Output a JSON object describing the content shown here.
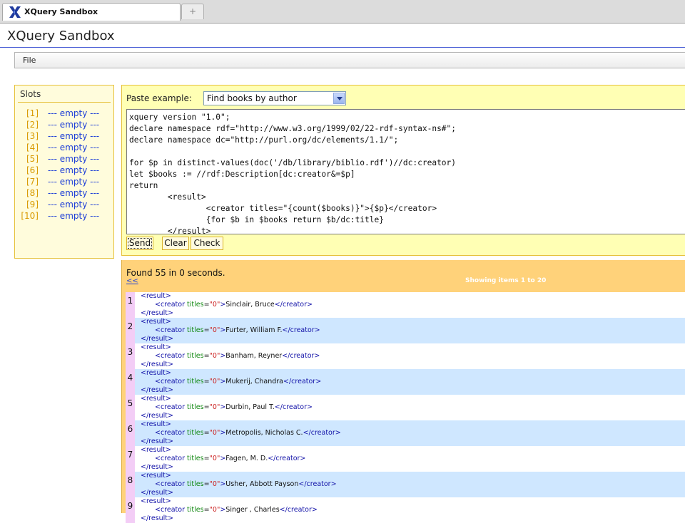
{
  "browser": {
    "tab_title": "XQuery Sandbox",
    "new_tab_symbol": "+"
  },
  "page": {
    "title": "XQuery Sandbox",
    "menu": {
      "file_label": "File"
    }
  },
  "slots": {
    "heading": "Slots",
    "items": [
      {
        "index": "[1]",
        "value": "--- empty ---"
      },
      {
        "index": "[2]",
        "value": "--- empty ---"
      },
      {
        "index": "[3]",
        "value": "--- empty ---"
      },
      {
        "index": "[4]",
        "value": "--- empty ---"
      },
      {
        "index": "[5]",
        "value": "--- empty ---"
      },
      {
        "index": "[6]",
        "value": "--- empty ---"
      },
      {
        "index": "[7]",
        "value": "--- empty ---"
      },
      {
        "index": "[8]",
        "value": "--- empty ---"
      },
      {
        "index": "[9]",
        "value": "--- empty ---"
      },
      {
        "index": "[10]",
        "value": "--- empty ---"
      }
    ]
  },
  "query": {
    "paste_label": "Paste example:",
    "paste_selected": "Find books by author",
    "code": "xquery version \"1.0\";\ndeclare namespace rdf=\"http://www.w3.org/1999/02/22-rdf-syntax-ns#\";\ndeclare namespace dc=\"http://purl.org/dc/elements/1.1/\";\n\nfor $p in distinct-values(doc('/db/library/biblio.rdf')//dc:creator)\nlet $books := //rdf:Description[dc:creator&=$p]\nreturn\n        <result>\n                <creator titles=\"{count($books)}\">{$p}</creator>\n                {for $b in $books return $b/dc:title}\n        </result>",
    "buttons": {
      "send": "Send",
      "clear": "Clear",
      "check": "Check"
    }
  },
  "results": {
    "found_text": "Found 55 in 0 seconds.",
    "prev_link": "<<",
    "showing_text": "Showing items 1 to 20",
    "tag_open": "<result>",
    "tag_close": "</result>",
    "creator_open": "<creator",
    "attr_name": "titles",
    "attr_eq": "=",
    "creator_close": "</creator>",
    "items": [
      {
        "num": "1",
        "titles": "\"0\"",
        "name": "Sinclair, Bruce"
      },
      {
        "num": "2",
        "titles": "\"0\"",
        "name": "Furter, William F."
      },
      {
        "num": "3",
        "titles": "\"0\"",
        "name": "Banham, Reyner"
      },
      {
        "num": "4",
        "titles": "\"0\"",
        "name": "Mukerij, Chandra"
      },
      {
        "num": "5",
        "titles": "\"0\"",
        "name": "Durbin, Paul T."
      },
      {
        "num": "6",
        "titles": "\"0\"",
        "name": "Metropolis, Nicholas C."
      },
      {
        "num": "7",
        "titles": "\"0\"",
        "name": "Fagen, M. D."
      },
      {
        "num": "8",
        "titles": "\"0\"",
        "name": "Usher, Abbott Payson"
      },
      {
        "num": "9",
        "titles": "\"0\"",
        "name": "Singer , Charles"
      }
    ]
  },
  "colors": {
    "row_alt": "#cfe7ff",
    "row_plain": "#ffffff",
    "num_cell": "#f3cdf6",
    "results_bg": "#ffd27a",
    "panel_bg": "#ffffb4"
  }
}
